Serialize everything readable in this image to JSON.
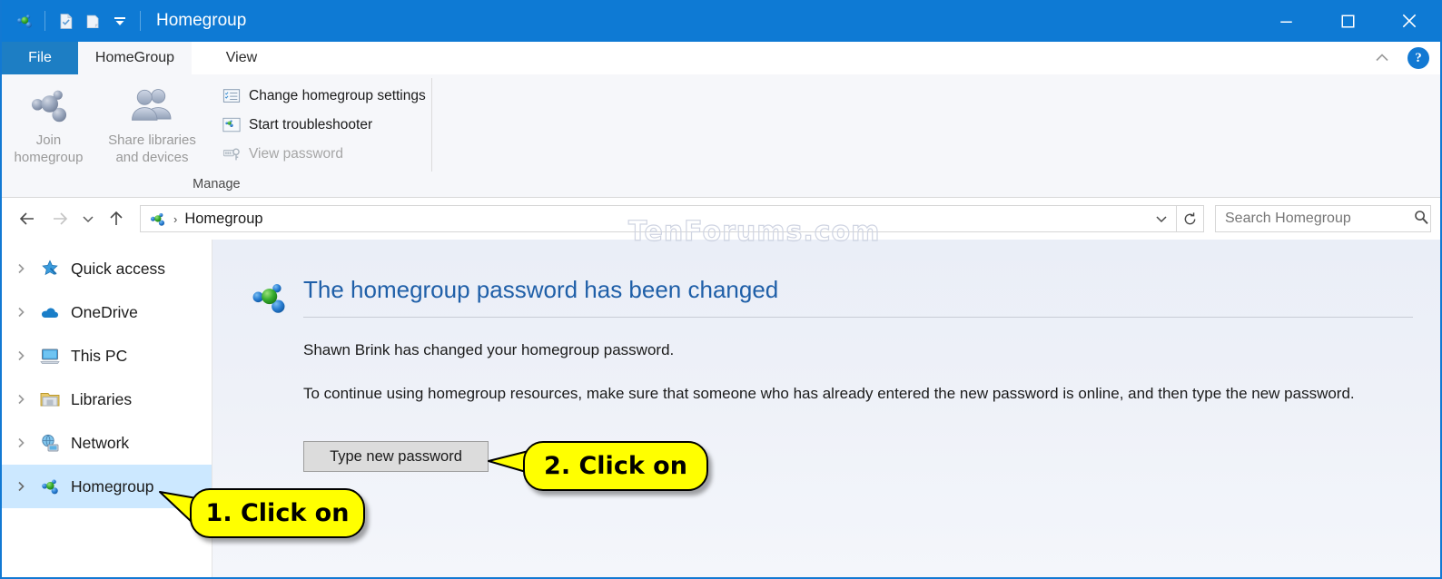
{
  "window": {
    "title": "Homegroup",
    "quick_access_icons": [
      "homegroup-icon",
      "properties-icon",
      "new-folder-icon",
      "customize-dropdown-icon"
    ],
    "controls": {
      "minimize": "minimize-icon",
      "maximize": "maximize-icon",
      "close": "close-icon"
    }
  },
  "tabs": {
    "file": "File",
    "items": [
      {
        "label": "HomeGroup",
        "active": true
      },
      {
        "label": "View",
        "active": false
      }
    ],
    "collapse_ribbon": "chevron-up-icon",
    "help": "?"
  },
  "ribbon": {
    "group_label": "Manage",
    "big_buttons": [
      {
        "label_line1": "Join",
        "label_line2": "homegroup",
        "icon": "homegroup-icon",
        "disabled": true
      },
      {
        "label_line1": "Share libraries",
        "label_line2": "and devices",
        "icon": "users-icon",
        "disabled": true
      }
    ],
    "small_buttons": [
      {
        "label": "Change homegroup settings",
        "icon": "settings-list-icon",
        "disabled": false
      },
      {
        "label": "Start troubleshooter",
        "icon": "homegroup-icon",
        "disabled": false
      },
      {
        "label": "View password",
        "icon": "key-icon",
        "disabled": true
      }
    ]
  },
  "addressbar": {
    "back": "back-arrow-icon",
    "forward": "forward-arrow-icon",
    "recent": "chevron-down-icon",
    "up": "up-arrow-icon",
    "crumb_icon": "homegroup-icon",
    "crumb_separator": "›",
    "crumb_text": "Homegroup",
    "dropdown": "chevron-down-icon",
    "refresh": "refresh-icon",
    "search_placeholder": "Search Homegroup",
    "search_value": "",
    "search_icon": "search-icon"
  },
  "navpane": {
    "items": [
      {
        "label": "Quick access",
        "icon": "star-pin-icon",
        "selected": false
      },
      {
        "label": "OneDrive",
        "icon": "cloud-icon",
        "selected": false
      },
      {
        "label": "This PC",
        "icon": "monitor-icon",
        "selected": false
      },
      {
        "label": "Libraries",
        "icon": "libraries-folder-icon",
        "selected": false
      },
      {
        "label": "Network",
        "icon": "network-icon",
        "selected": false
      },
      {
        "label": "Homegroup",
        "icon": "homegroup-icon",
        "selected": true
      }
    ]
  },
  "content": {
    "icon": "homegroup-icon",
    "title": "The homegroup password has been changed",
    "paragraph_1": "Shawn Brink has changed your homegroup password.",
    "paragraph_2": "To continue using homegroup resources, make sure that someone who has already entered the new password is online, and then type the new password.",
    "button_label": "Type new password"
  },
  "watermark": "TenForums.com",
  "callouts": [
    {
      "text": "1. Click on"
    },
    {
      "text": "2. Click on"
    }
  ],
  "colors": {
    "titlebar": "#0e7ad4",
    "accent": "#1279d3",
    "ribbon_bg": "#f6f7fa",
    "selection": "#cce8ff",
    "content_bg": "#eef1f8",
    "heading": "#1f5fa8",
    "callout_bg": "#ffff00"
  }
}
